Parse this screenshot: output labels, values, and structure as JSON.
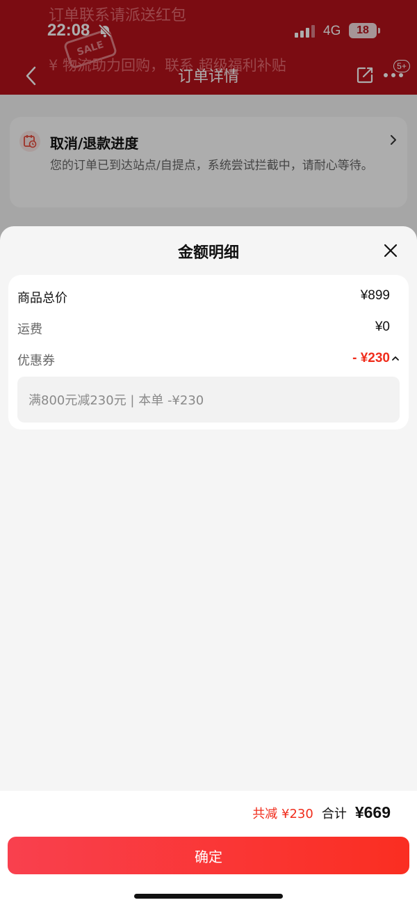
{
  "status_bar": {
    "time": "22:08",
    "network": "4G",
    "battery": "18"
  },
  "banner": {
    "line1": "订单联系请派送红包",
    "badge": "SALE",
    "line2": "¥ 物流助力回购，联系 超级福利补贴"
  },
  "nav": {
    "title": "订单详情",
    "badge": "5+"
  },
  "progress_card": {
    "title": "取消/退款进度",
    "description": "您的订单已到达站点/自提点，系统尝试拦截中，请耐心等待。"
  },
  "sheet": {
    "title": "金额明细",
    "rows": [
      {
        "label": "商品总价",
        "value": "¥899"
      },
      {
        "label": "运费",
        "value": "¥0"
      },
      {
        "label": "优惠券",
        "value": "- ¥230"
      }
    ],
    "coupon_detail": "满800元减230元 | 本单 -¥230"
  },
  "footer": {
    "saved": "共减 ¥230",
    "total_label": "合计",
    "total_value": "¥669",
    "confirm_label": "确定"
  },
  "colors": {
    "accent": "#f02d1c",
    "header": "#b5121b",
    "button_start": "#f9404e",
    "button_end": "#fa2e21"
  }
}
